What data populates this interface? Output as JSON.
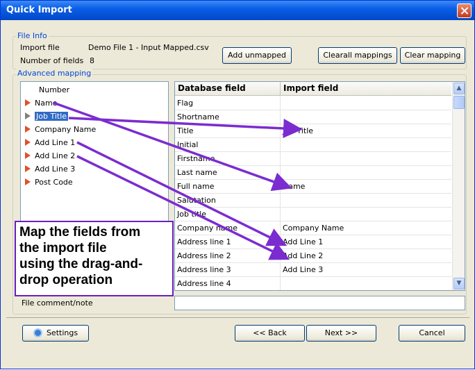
{
  "window": {
    "title": "Quick Import"
  },
  "file_info": {
    "legend": "File Info",
    "import_file_label": "Import file",
    "import_file_value": "Demo File 1 - Input Mapped.csv",
    "num_fields_label": "Number of fields",
    "num_fields_value": "8"
  },
  "buttons": {
    "add_unmapped": "Add unmapped",
    "clearall_mappings": "Clearall mappings",
    "clear_mapping": "Clear mapping",
    "settings": "Settings",
    "back": "<< Back",
    "next": "Next >>",
    "cancel": "Cancel"
  },
  "advanced_mapping": {
    "legend": "Advanced mapping",
    "import_fields": [
      {
        "label": "Number",
        "arrow": "none"
      },
      {
        "label": "Name",
        "arrow": "red"
      },
      {
        "label": "Job Title",
        "arrow": "grey",
        "selected": true
      },
      {
        "label": "Company Name",
        "arrow": "red"
      },
      {
        "label": "Add Line 1",
        "arrow": "red"
      },
      {
        "label": "Add Line 2",
        "arrow": "red"
      },
      {
        "label": "Add Line 3",
        "arrow": "red"
      },
      {
        "label": "Post Code",
        "arrow": "red"
      }
    ]
  },
  "grid": {
    "columns": [
      "Database field",
      "Import field"
    ],
    "rows": [
      [
        "Flag",
        ""
      ],
      [
        "Shortname",
        ""
      ],
      [
        "Title",
        "Job Title"
      ],
      [
        "Initial",
        ""
      ],
      [
        "Firstname",
        ""
      ],
      [
        "Last name",
        ""
      ],
      [
        "Full name",
        "Name"
      ],
      [
        "Salutation",
        ""
      ],
      [
        "Job title",
        ""
      ],
      [
        "Company name",
        "Company Name"
      ],
      [
        "Address line 1",
        "Add Line 1"
      ],
      [
        "Address line 2",
        "Add Line 2"
      ],
      [
        "Address line 3",
        "Add Line 3"
      ],
      [
        "Address line 4",
        ""
      ]
    ]
  },
  "callout": {
    "lines": [
      "Map the fields from",
      "the import file",
      "using the drag-and-",
      "drop operation"
    ]
  },
  "comment": {
    "label": "File comment/note",
    "value": ""
  },
  "colors": {
    "title_bar": "#0a5ee6",
    "selection": "#316ac5",
    "annotation": "#7b2cd0"
  },
  "icons": {
    "settings": "gear-icon",
    "close": "close-icon",
    "field_marker": "triangle-right-icon"
  }
}
